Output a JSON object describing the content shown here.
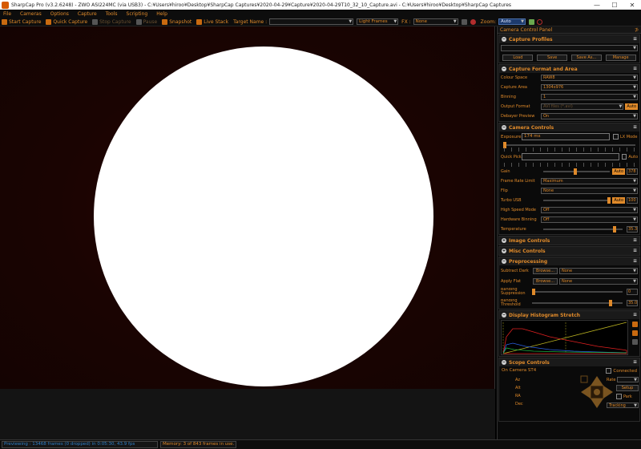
{
  "titlebar": {
    "title": "SharpCap Pro (v3.2.6248) - ZWO ASI224MC (via USB3) - C:¥Users¥hiroo¥Desktop¥SharpCap Captures¥2020-04-29¥Capture¥2020-04-29T10_32_10_Capture.avi - C:¥Users¥hiroo¥Desktop¥SharpCap Captures",
    "minimize": "—",
    "maximize": "☐",
    "close": "✕"
  },
  "menu": [
    "File",
    "Cameras",
    "Options",
    "Capture",
    "Tools",
    "Scripting",
    "Help"
  ],
  "toolbar": {
    "start_capture": "Start Capture",
    "quick_capture": "Quick Capture",
    "stop_capture": "Stop Capture",
    "pause": "Pause",
    "snapshot": "Snapshot",
    "live_stack": "Live Stack",
    "target_name_label": "Target Name :",
    "target_name_value": "",
    "frame_type": "Light Frames",
    "fx_label": "FX :",
    "fx_value": "None",
    "zoom_label": "Zoom:",
    "zoom_value": "Auto"
  },
  "status": {
    "preview": "Previewing : 13468 frames (0 dropped) in 0:05:30, 43.9 fps",
    "memory": "Memory: 3 of 843 frames in use."
  },
  "panel": {
    "title": "Camera Control Panel",
    "pin": "⊅",
    "capture_profiles": {
      "title": "Capture Profiles",
      "profile_value": "",
      "load": "Load",
      "save": "Save",
      "save_as": "Save As...",
      "manage": "Manage"
    },
    "format_area": {
      "title": "Capture Format and Area",
      "rows": [
        {
          "label": "Colour Space",
          "value": "RAW8"
        },
        {
          "label": "Capture Area",
          "value": "1304x976"
        },
        {
          "label": "Binning",
          "value": "1"
        },
        {
          "label": "Output Format",
          "value": "AVI files (*.avi)"
        },
        {
          "label": "Debayer Preview",
          "value": "On"
        }
      ],
      "auto": "Auto"
    },
    "camera_controls": {
      "title": "Camera Controls",
      "exposure_label": "Exposure",
      "exposure_value": "174 ms",
      "lx_mode": "LX Mode",
      "quick_picks": "Quick Picks",
      "auto": "Auto",
      "gain_label": "Gain",
      "gain_auto": "Auto",
      "gain_value": "378",
      "frame_rate_label": "Frame Rate Limit",
      "frame_rate_value": "Maximum",
      "flip_label": "Flip",
      "flip_value": "None",
      "turbo_label": "Turbo USB",
      "turbo_auto": "Auto",
      "turbo_value": "100",
      "hsm_label": "High Speed Mode",
      "hsm_value": "Off",
      "hwbin_label": "Hardware Binning",
      "hwbin_value": "Off",
      "temp_label": "Temperature",
      "temp_value": "35.3"
    },
    "image_controls": {
      "title": "Image Controls"
    },
    "misc_controls": {
      "title": "Misc Controls"
    },
    "preprocessing": {
      "title": "Preprocessing",
      "subtract_label": "Subtract Dark",
      "browse": "Browse...",
      "subtract_value": "None",
      "flat_label": "Apply Flat",
      "flat_value": "None",
      "bsup_label": "Banding Suppression",
      "bsup_value": "0",
      "bthr_label": "Banding Threshold",
      "bthr_value": "35.0"
    },
    "histogram": {
      "title": "Display Histogram Stretch"
    },
    "scope": {
      "title": "Scope Controls",
      "name": "On Camera ST4",
      "connected": "Connected",
      "az": "Az",
      "alt": "Alt",
      "ra": "RA",
      "dec": "Dec",
      "rate_label": "Rate",
      "setup": "Setup",
      "park": "Park",
      "tracking": "Tracking"
    }
  },
  "colors": {
    "accent": "#e08a2a",
    "background": "#0a0a0a",
    "status_blue": "#2f80c8",
    "sun_limb": "#c81c06"
  }
}
